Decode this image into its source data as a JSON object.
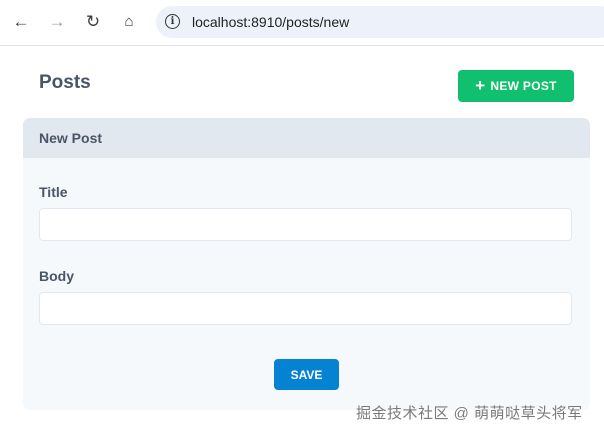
{
  "browser": {
    "url": "localhost:8910/posts/new",
    "icons": [
      "back-icon",
      "forward-icon",
      "reload-icon",
      "home-icon",
      "info-icon"
    ]
  },
  "page": {
    "title": "Posts",
    "new_post_label": "NEW POST",
    "new_post_icon": "+"
  },
  "card": {
    "header": "New Post",
    "title_label": "Title",
    "title_value": "",
    "body_label": "Body",
    "body_value": "",
    "save_label": "SAVE"
  },
  "watermark": "掘金技术社区 @ 萌萌哒草头将军",
  "colors": {
    "accent_green": "#10c06e",
    "save_blue": "#0582d2"
  }
}
